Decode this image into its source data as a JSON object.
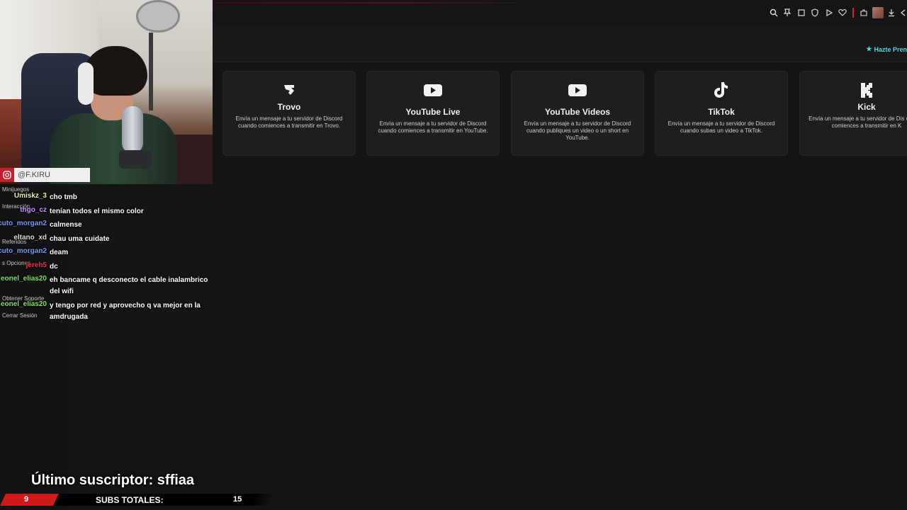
{
  "browser_toolbar": {
    "icons": [
      "zoom-icon",
      "pin-icon",
      "bookmark-icon",
      "shield-icon",
      "play-icon",
      "heart-icon",
      "extensions-icon",
      "profile-avatar",
      "download-icon",
      "back-icon"
    ]
  },
  "premium_link": "Hazte Pren",
  "sidebar": {
    "items": [
      "Minijuegos",
      "Interacción",
      "Referidos",
      "s Opciones",
      "Obtener Soporte",
      "Cerrar Sesión"
    ]
  },
  "cards": [
    {
      "title": "Trovo",
      "description": "Envía un mensaje a tu servidor de Discord cuando comiences a transmitir en Trovo.",
      "icon": "trovo-icon"
    },
    {
      "title": "YouTube Live",
      "description": "Envía un mensaje a tu servidor de Discord cuando comiences a transmitir en YouTube.",
      "icon": "youtube-live-icon"
    },
    {
      "title": "YouTube Videos",
      "description": "Envía un mensaje a tu servidor de Discord cuando publiques un video o un short en YouTube.",
      "icon": "youtube-icon"
    },
    {
      "title": "TikTok",
      "description": "Envía un mensaje a tu servidor de Discord cuando subas un video a TikTok.",
      "icon": "tiktok-icon"
    },
    {
      "title": "Kick",
      "description": "Envía un mensaje a tu servidor de Dis cuando comiences a transmitir en K",
      "icon": "kick-icon"
    }
  ],
  "webcam": {
    "instagram_handle": "@F.KIRU"
  },
  "chat": {
    "messages": [
      {
        "user": "Umiskz_3",
        "text": "cho tmb",
        "color": "#f0f0a8"
      },
      {
        "user": "thgo_cz",
        "text": "tenían todos el mismo color",
        "color": "#c792ff"
      },
      {
        "user": "cuto_morgan2",
        "text": "calmense",
        "color": "#6e9bff"
      },
      {
        "user": "eltano_xd",
        "text": "chau uma cuidate",
        "color": "#dcdcdc"
      },
      {
        "user": "cuto_morgan2",
        "text": "deam",
        "color": "#6e9bff"
      },
      {
        "user": "jereh5",
        "text": "dc",
        "color": "#ff2a4a"
      },
      {
        "user": "eonel_elias20",
        "text": "eh bancame q desconecto el cable inalambrico del wifi",
        "color": "#7fe060"
      },
      {
        "user": "eonel_elias20",
        "text": "y tengo por red y aprovecho q va mejor en la amdrugada",
        "color": "#7fe060"
      }
    ]
  },
  "overlay": {
    "last_subscriber": "Último suscriptor: sffiaa",
    "left_count": "9",
    "subs_label": "SUBS TOTALES:",
    "right_count": "15"
  }
}
